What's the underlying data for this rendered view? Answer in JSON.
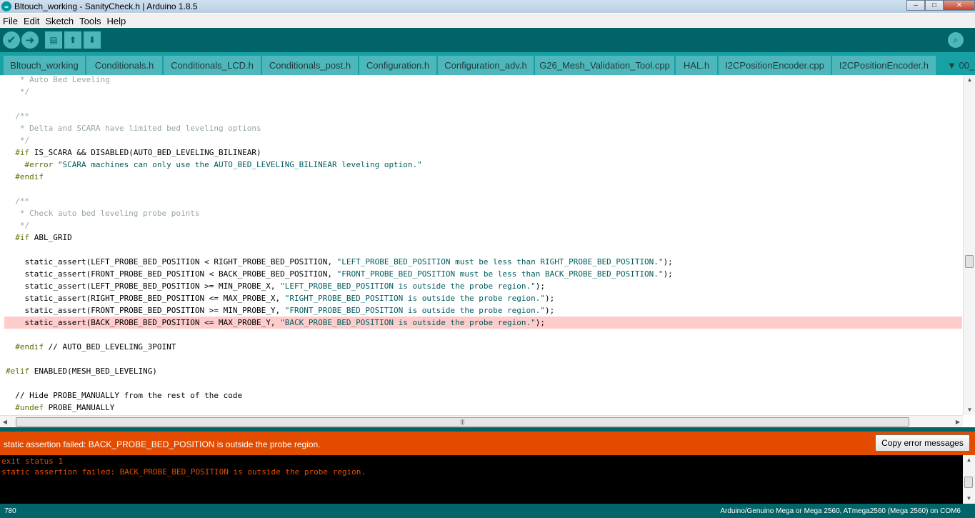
{
  "window": {
    "title": "Bltouch_working - SanityCheck.h | Arduino 1.8.5",
    "minimize_glyph": "–",
    "maximize_glyph": "□",
    "close_glyph": "✕"
  },
  "menu": [
    "File",
    "Edit",
    "Sketch",
    "Tools",
    "Help"
  ],
  "toolbar": {
    "verify_icon": "check-icon",
    "upload_icon": "arrow-right-icon",
    "new_icon": "new-file-icon",
    "open_icon": "arrow-up-icon",
    "save_icon": "arrow-down-icon",
    "serial_monitor_icon": "magnifier-icon"
  },
  "tabs": [
    {
      "label": "Bltouch_working",
      "active": false
    },
    {
      "label": "Conditionals.h",
      "active": false
    },
    {
      "label": "Conditionals_LCD.h",
      "active": false
    },
    {
      "label": "Conditionals_post.h",
      "active": false
    },
    {
      "label": "Configuration.h",
      "active": false
    },
    {
      "label": "Configuration_adv.h",
      "active": false
    },
    {
      "label": "G26_Mesh_Validation_Tool.cpp",
      "active": false
    },
    {
      "label": "HAL.h",
      "active": false
    },
    {
      "label": "I2CPositionEncoder.cpp",
      "active": false
    },
    {
      "label": "I2CPositionEncoder.h",
      "active": false
    }
  ],
  "tab_overflow_label": "▼ 00_",
  "editor": {
    "highlighted_line": 20,
    "lines": [
      [
        {
          "t": "   * Auto Bed Leveling",
          "c": "comment"
        }
      ],
      [
        {
          "t": "   */",
          "c": "comment"
        }
      ],
      [],
      [
        {
          "t": "  /**",
          "c": "comment"
        }
      ],
      [
        {
          "t": "   * Delta and SCARA have limited bed leveling options",
          "c": "comment"
        }
      ],
      [
        {
          "t": "   */",
          "c": "comment"
        }
      ],
      [
        {
          "t": "  #if",
          "c": "kw"
        },
        {
          "t": " IS_SCARA && DISABLED(AUTO_BED_LEVELING_BILINEAR)",
          "c": ""
        }
      ],
      [
        {
          "t": "    #error",
          "c": "kw"
        },
        {
          "t": " ",
          "c": ""
        },
        {
          "t": "\"SCARA machines can only use the AUTO_BED_LEVELING_BILINEAR leveling option.\"",
          "c": "str"
        }
      ],
      [
        {
          "t": "  #endif",
          "c": "kw"
        }
      ],
      [],
      [
        {
          "t": "  /**",
          "c": "comment"
        }
      ],
      [
        {
          "t": "   * Check auto bed leveling probe points",
          "c": "comment"
        }
      ],
      [
        {
          "t": "   */",
          "c": "comment"
        }
      ],
      [
        {
          "t": "  #if",
          "c": "kw"
        },
        {
          "t": " ABL_GRID",
          "c": ""
        }
      ],
      [],
      [
        {
          "t": "    static_assert(LEFT_PROBE_BED_POSITION < RIGHT_PROBE_BED_POSITION, ",
          "c": ""
        },
        {
          "t": "\"LEFT_PROBE_BED_POSITION must be less than RIGHT_PROBE_BED_POSITION.\"",
          "c": "str"
        },
        {
          "t": ");",
          "c": ""
        }
      ],
      [
        {
          "t": "    static_assert(FRONT_PROBE_BED_POSITION < BACK_PROBE_BED_POSITION, ",
          "c": ""
        },
        {
          "t": "\"FRONT_PROBE_BED_POSITION must be less than BACK_PROBE_BED_POSITION.\"",
          "c": "str"
        },
        {
          "t": ");",
          "c": ""
        }
      ],
      [
        {
          "t": "    static_assert(LEFT_PROBE_BED_POSITION >= MIN_PROBE_X, ",
          "c": ""
        },
        {
          "t": "\"LEFT_PROBE_BED_POSITION is outside the probe region.\"",
          "c": "str"
        },
        {
          "t": ");",
          "c": ""
        }
      ],
      [
        {
          "t": "    static_assert(RIGHT_PROBE_BED_POSITION <= MAX_PROBE_X, ",
          "c": ""
        },
        {
          "t": "\"RIGHT_PROBE_BED_POSITION is outside the probe region.\"",
          "c": "str"
        },
        {
          "t": ");",
          "c": ""
        }
      ],
      [
        {
          "t": "    static_assert(FRONT_PROBE_BED_POSITION >= MIN_PROBE_Y, ",
          "c": ""
        },
        {
          "t": "\"FRONT_PROBE_BED_POSITION is outside the probe region.\"",
          "c": "str"
        },
        {
          "t": ");",
          "c": ""
        }
      ],
      [
        {
          "t": "    static_assert(BACK_PROBE_BED_POSITION <= MAX_PROBE_Y, ",
          "c": ""
        },
        {
          "t": "\"BACK_PROBE_BED_POSITION is outside the probe region.\"",
          "c": "str"
        },
        {
          "t": ");",
          "c": ""
        }
      ],
      [],
      [
        {
          "t": "  #endif",
          "c": "kw"
        },
        {
          "t": " // AUTO_BED_LEVELING_3POINT",
          "c": ""
        }
      ],
      [],
      [
        {
          "t": "#elif",
          "c": "kw"
        },
        {
          "t": " ENABLED(MESH_BED_LEVELING)",
          "c": ""
        }
      ],
      [],
      [
        {
          "t": "  // Hide PROBE_MANUALLY from the rest of the code",
          "c": ""
        }
      ],
      [
        {
          "t": "  #undef",
          "c": "kw"
        },
        {
          "t": " PROBE_MANUALLY",
          "c": ""
        }
      ]
    ]
  },
  "scroll": {
    "up_arrow": "▲",
    "down_arrow": "▼",
    "left_arrow": "◀",
    "right_arrow": "▶",
    "grip": "|||",
    "hgrip": "≡"
  },
  "error": {
    "message": "static assertion failed: BACK_PROBE_BED_POSITION is outside the probe region.",
    "copy_button": "Copy error messages"
  },
  "console": [
    "exit status 1",
    "static assertion failed: BACK_PROBE_BED_POSITION is outside the probe region."
  ],
  "status": {
    "line_number": "780",
    "board": "Arduino/Genuino Mega or Mega 2560, ATmega2560 (Mega 2560) on COM6"
  }
}
